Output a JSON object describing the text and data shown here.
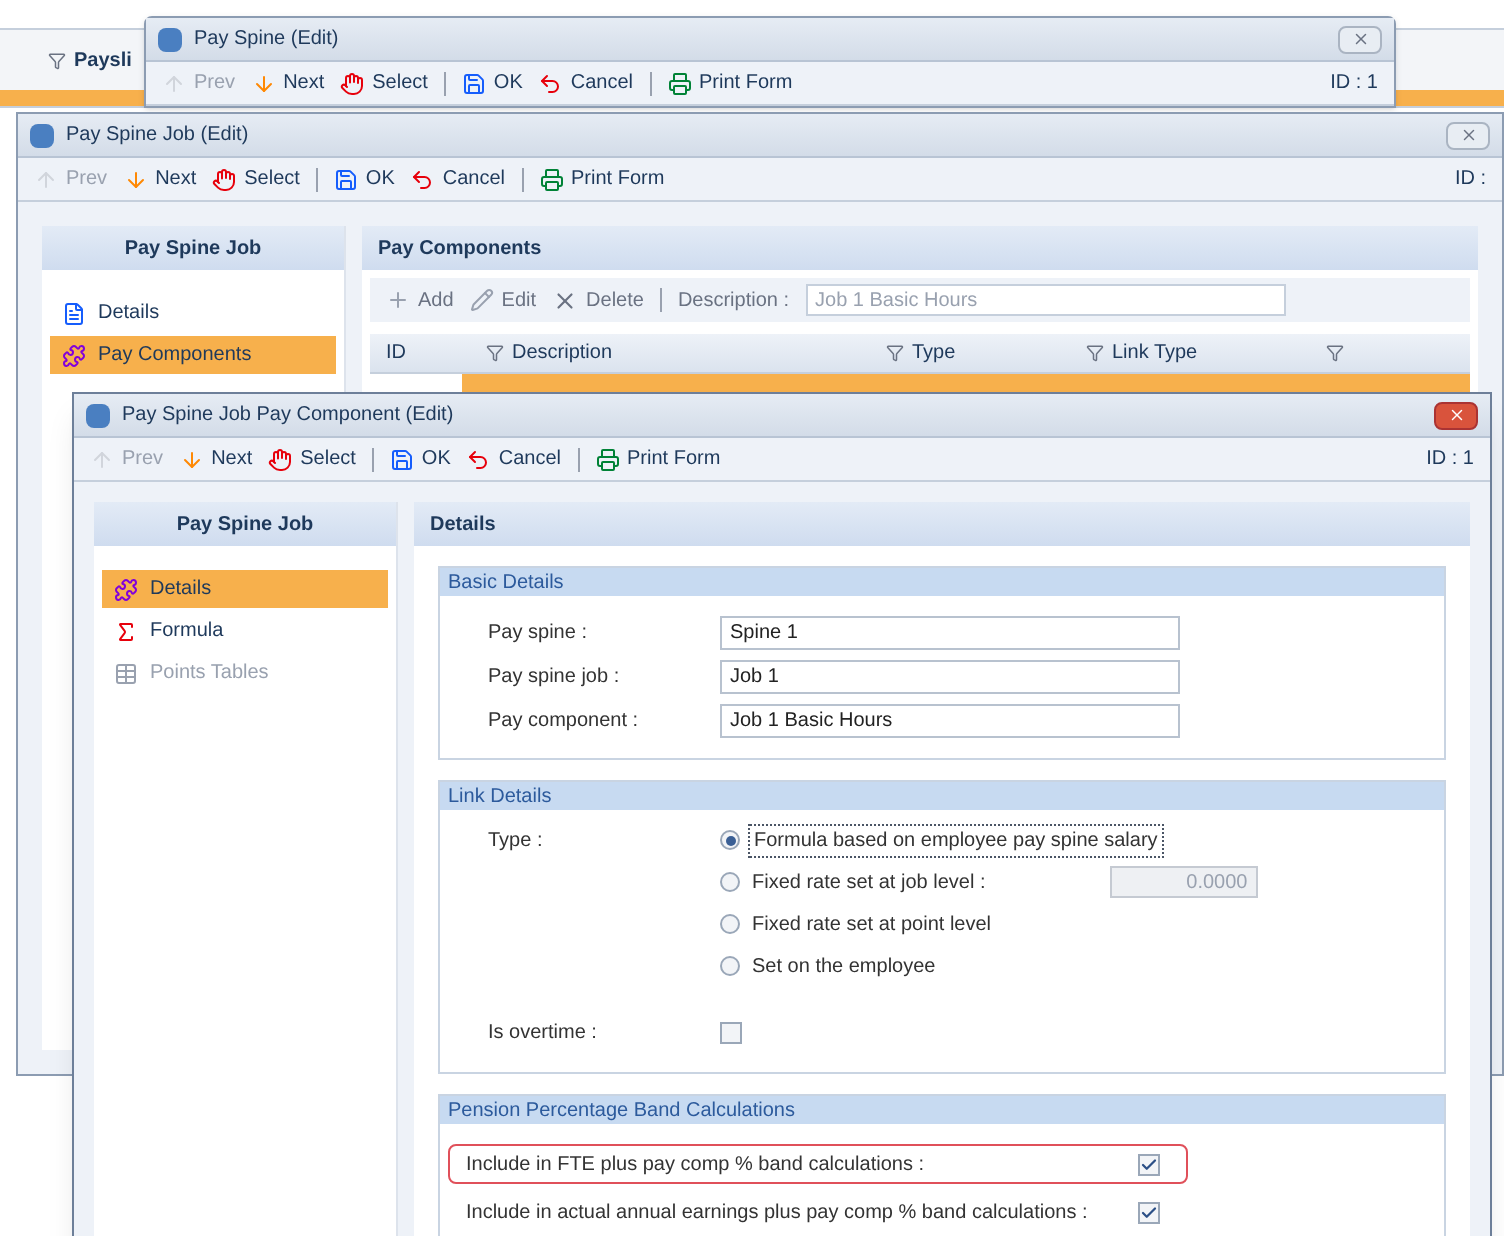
{
  "background_window": {
    "tab": "Paysli"
  },
  "pay_spine_window": {
    "title": "Pay Spine (Edit)",
    "id_label": "ID : 1",
    "toolbar": [
      {
        "kind": "prev",
        "label": "Prev",
        "disabled": true
      },
      {
        "kind": "next",
        "label": "Next",
        "disabled": false
      },
      {
        "kind": "select",
        "label": "Select",
        "disabled": false
      },
      {
        "kind": "ok",
        "label": "OK",
        "disabled": false
      },
      {
        "kind": "cancel",
        "label": "Cancel",
        "disabled": false
      },
      {
        "kind": "print",
        "label": "Print Form",
        "disabled": false
      }
    ]
  },
  "pay_spine_job_window": {
    "title": "Pay Spine Job (Edit)",
    "id_label": "ID :",
    "toolbar": [
      {
        "kind": "prev",
        "label": "Prev",
        "disabled": true
      },
      {
        "kind": "next",
        "label": "Next",
        "disabled": false
      },
      {
        "kind": "select",
        "label": "Select",
        "disabled": false
      },
      {
        "kind": "ok",
        "label": "OK",
        "disabled": false
      },
      {
        "kind": "cancel",
        "label": "Cancel",
        "disabled": false
      },
      {
        "kind": "print",
        "label": "Print Form",
        "disabled": false
      }
    ],
    "sidebar": {
      "title": "Pay Spine Job",
      "items": [
        {
          "kind": "details",
          "label": "Details",
          "selected": false,
          "disabled": false
        },
        {
          "kind": "components",
          "label": "Pay Components",
          "selected": true,
          "disabled": false
        }
      ]
    },
    "panel_title": "Pay Components",
    "grid_toolbar": [
      {
        "kind": "add",
        "label": "Add",
        "disabled": true
      },
      {
        "kind": "edit",
        "label": "Edit",
        "disabled": true
      },
      {
        "kind": "delete",
        "label": "Delete",
        "disabled": true
      }
    ],
    "description_filter": {
      "label": "Description :",
      "value": "Job 1 Basic Hours",
      "disabled": true
    },
    "grid": {
      "columns": [
        {
          "label": "ID",
          "filter": false
        },
        {
          "label": "Description",
          "filter": true
        },
        {
          "label": "Type",
          "filter": true
        },
        {
          "label": "Link Type",
          "filter": true
        },
        {
          "filter": true
        }
      ],
      "rows": [
        {
          "selected": true
        }
      ]
    }
  },
  "pay_component_window": {
    "title": "Pay Spine Job Pay Component (Edit)",
    "id_label": "ID : 1",
    "toolbar": [
      {
        "kind": "prev",
        "label": "Prev",
        "disabled": true
      },
      {
        "kind": "next",
        "label": "Next",
        "disabled": false
      },
      {
        "kind": "select",
        "label": "Select",
        "disabled": false
      },
      {
        "kind": "ok",
        "label": "OK",
        "disabled": false
      },
      {
        "kind": "cancel",
        "label": "Cancel",
        "disabled": false
      },
      {
        "kind": "print",
        "label": "Print Form",
        "disabled": false
      }
    ],
    "sidebar": {
      "title": "Pay Spine Job",
      "items": [
        {
          "kind": "components",
          "label": "Details",
          "selected": true,
          "disabled": false
        },
        {
          "kind": "formula",
          "label": "Formula",
          "selected": false,
          "disabled": false
        },
        {
          "kind": "table",
          "label": "Points Tables",
          "selected": false,
          "disabled": true
        }
      ]
    },
    "panel_title": "Details",
    "basic_details": {
      "title": "Basic Details",
      "fields": [
        {
          "label": "Pay spine :",
          "value": "Spine 1"
        },
        {
          "label": "Pay spine job :",
          "value": "Job 1"
        },
        {
          "label": "Pay component :",
          "value": "Job 1 Basic Hours"
        }
      ]
    },
    "link_details": {
      "title": "Link Details",
      "type_label": "Type :",
      "options": [
        {
          "label": "Formula based on employee pay spine salary",
          "selected": true
        },
        {
          "label": "Fixed rate set at job level :",
          "selected": false,
          "amount": "0.0000"
        },
        {
          "label": "Fixed rate set at point level",
          "selected": false
        },
        {
          "label": "Set on the employee",
          "selected": false
        }
      ],
      "overtime": {
        "label": "Is overtime :",
        "checked": false
      }
    },
    "pension": {
      "title": "Pension Percentage Band Calculations",
      "rows": [
        {
          "label": "Include in FTE plus pay comp % band calculations :",
          "checked": true,
          "highlighted": true
        },
        {
          "label": "Include in actual annual earnings plus pay comp % band calculations :",
          "checked": true,
          "highlighted": false
        }
      ]
    }
  }
}
